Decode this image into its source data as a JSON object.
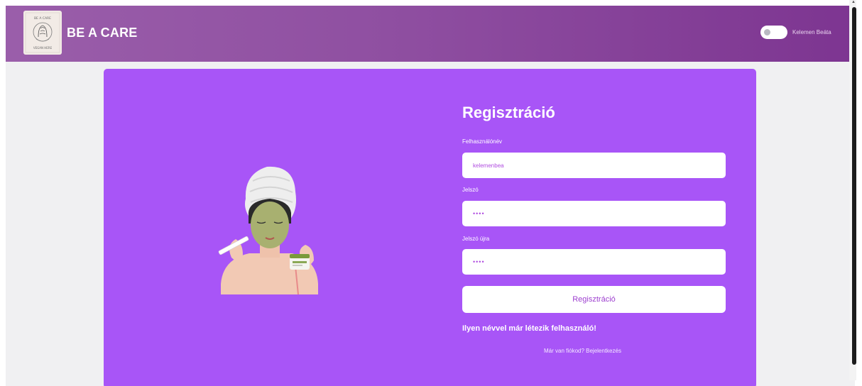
{
  "navbar": {
    "brand": "BE A CARE",
    "logo_text_top": "BE A CARE",
    "logo_text_bottom": "VEGAN HERE",
    "user_name": "Kelemen Beáta"
  },
  "form": {
    "title": "Regisztráció",
    "username_label": "Felhasználónév",
    "username_value": "kelemenbea",
    "password_label": "Jelszó",
    "password_value": "••••",
    "password_again_label": "Jelszó újra",
    "password_again_value": "••••",
    "submit_label": "Regisztráció",
    "error_message": "Ilyen névvel már létezik felhasználó!",
    "login_link": "Már van fiókod? Bejelentkezés"
  },
  "colors": {
    "navbar_start": "#9a5eaa",
    "navbar_end": "#7d3591",
    "card": "#a855f7",
    "page_bg": "#f0f0f2"
  },
  "icons": [
    "logo-emblem",
    "toggle-switch",
    "woman-face-mask-illustration"
  ]
}
